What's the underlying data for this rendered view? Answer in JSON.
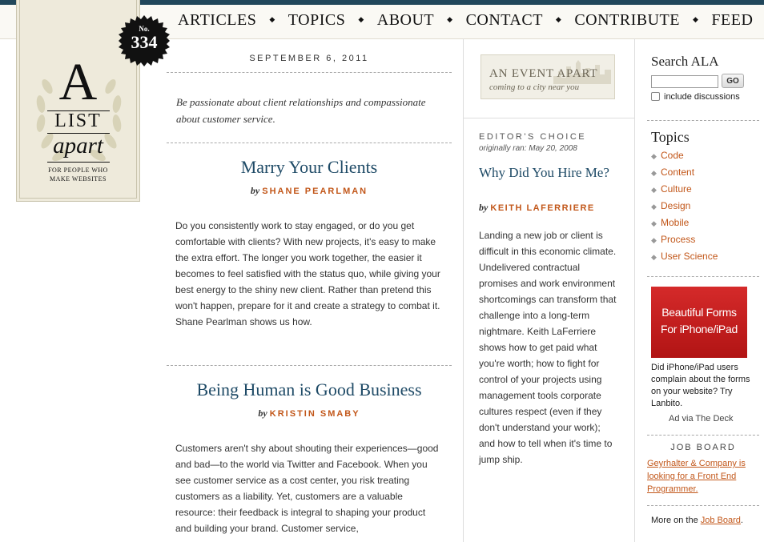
{
  "nav": [
    "ARTICLES",
    "TOPICS",
    "ABOUT",
    "CONTACT",
    "CONTRIBUTE",
    "FEED"
  ],
  "logo": {
    "a": "A",
    "list": "LIST",
    "apart": "apart",
    "tagline_1": "FOR PEOPLE WHO",
    "tagline_2": "MAKE WEBSITES"
  },
  "issue": {
    "no": "No.",
    "number": "334"
  },
  "issue_date": "SEPTEMBER 6, 2011",
  "intro": "Be passionate about client relationships and compassionate about customer service.",
  "articles": [
    {
      "title": "Marry Your Clients",
      "by": "by",
      "author": "SHANE PEARLMAN",
      "body": "Do you consistently work to stay engaged, or do you get comfortable with clients? With new projects, it's easy to make the extra effort. The longer you work together, the easier it becomes to feel satisfied with the status quo, while giving your best energy to the shiny new client. Rather than pretend this won't happen, prepare for it and create a strategy to combat it. Shane Pearlman shows us how."
    },
    {
      "title": "Being Human is Good Business",
      "by": "by",
      "author": "KRISTIN SMABY",
      "body": "Customers aren't shy about shouting their experiences—good and bad—to the world via Twitter and Facebook. When you see customer service as a cost center, you risk treating customers as a liability. Yet, customers are a valuable resource: their feedback is integral to shaping your product and building your brand. Customer service,"
    }
  ],
  "event_apart": {
    "title": "AN EVENT APART",
    "subtitle": "coming to a city near you"
  },
  "editors_choice": {
    "label": "EDITOR'S CHOICE",
    "originally_ran": "originally ran: May 20, 2008",
    "title": "Why Did You Hire Me?",
    "by": "by",
    "author": "KEITH LAFERRIERE",
    "body": "Landing a new job or client is difficult in this economic climate. Undelivered contractual promises and work environment shortcomings can transform that challenge into a long-term nightmare. Keith LaFerriere shows how to get paid what you're worth; how to fight for control of your projects using management tools corporate cultures respect (even if they don't understand your work); and how to tell when it's time to jump ship."
  },
  "search": {
    "title": "Search ALA",
    "value": "",
    "go": "GO",
    "include_label": "include discussions"
  },
  "topics": {
    "title": "Topics",
    "items": [
      "Code",
      "Content",
      "Culture",
      "Design",
      "Mobile",
      "Process",
      "User Science"
    ]
  },
  "ad": {
    "line1": "Beautiful Forms",
    "line2": "For iPhone/iPad",
    "text": "Did iPhone/iPad users complain about the forms on your website? Try Lanbito.",
    "via": "Ad via The Deck"
  },
  "job_board": {
    "label": "JOB BOARD",
    "listing": "Geyrhalter & Company is looking for a Front End Programmer.",
    "more_prefix": "More on the",
    "more_link": "Job Board",
    "more_suffix": "."
  },
  "colors": {
    "accent": "#c2571a",
    "title": "#1e4a66",
    "topbar": "#21475b"
  }
}
